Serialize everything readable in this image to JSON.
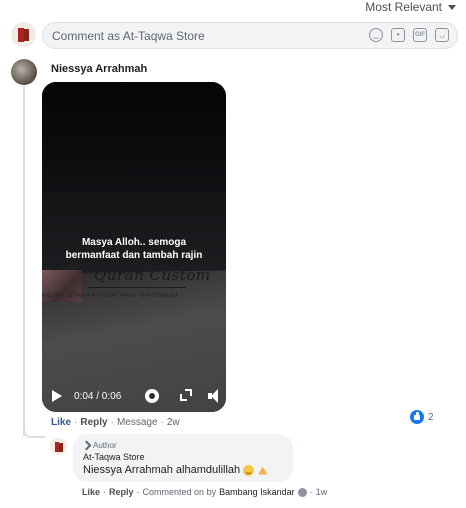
{
  "sort": {
    "label": "Most Relevant"
  },
  "composer": {
    "placeholder": "Comment as At-Taqwa Store"
  },
  "comment": {
    "author": "Niessya Arrahmah",
    "video": {
      "caption": "Masya Alloh.. semoga bermanfaat dan tambah rajin",
      "brand": "Quran Custom",
      "brand_subtitle": "HADIAH ISTIMEWA UNTUK YANG TERISTIMEWA",
      "time": "0:04 / 0:06"
    },
    "actions": {
      "like": "Like",
      "reply": "Reply",
      "message": "Message",
      "age": "2w",
      "dot": "·"
    },
    "like_count": "2"
  },
  "reply": {
    "badge": "Author",
    "name": "At-Taqwa Store",
    "text": "Niessya Arrahmah alhamdulillah",
    "actions": {
      "like": "Like",
      "reply": "Reply",
      "commented_on_by": "Commented on by",
      "commenter": "Bambang Iskandar",
      "age": "1w",
      "dot": "·"
    }
  },
  "colors": {
    "link_blue": "#385898",
    "like_blue": "#1877f2",
    "bubble": "#f2f3f5"
  }
}
